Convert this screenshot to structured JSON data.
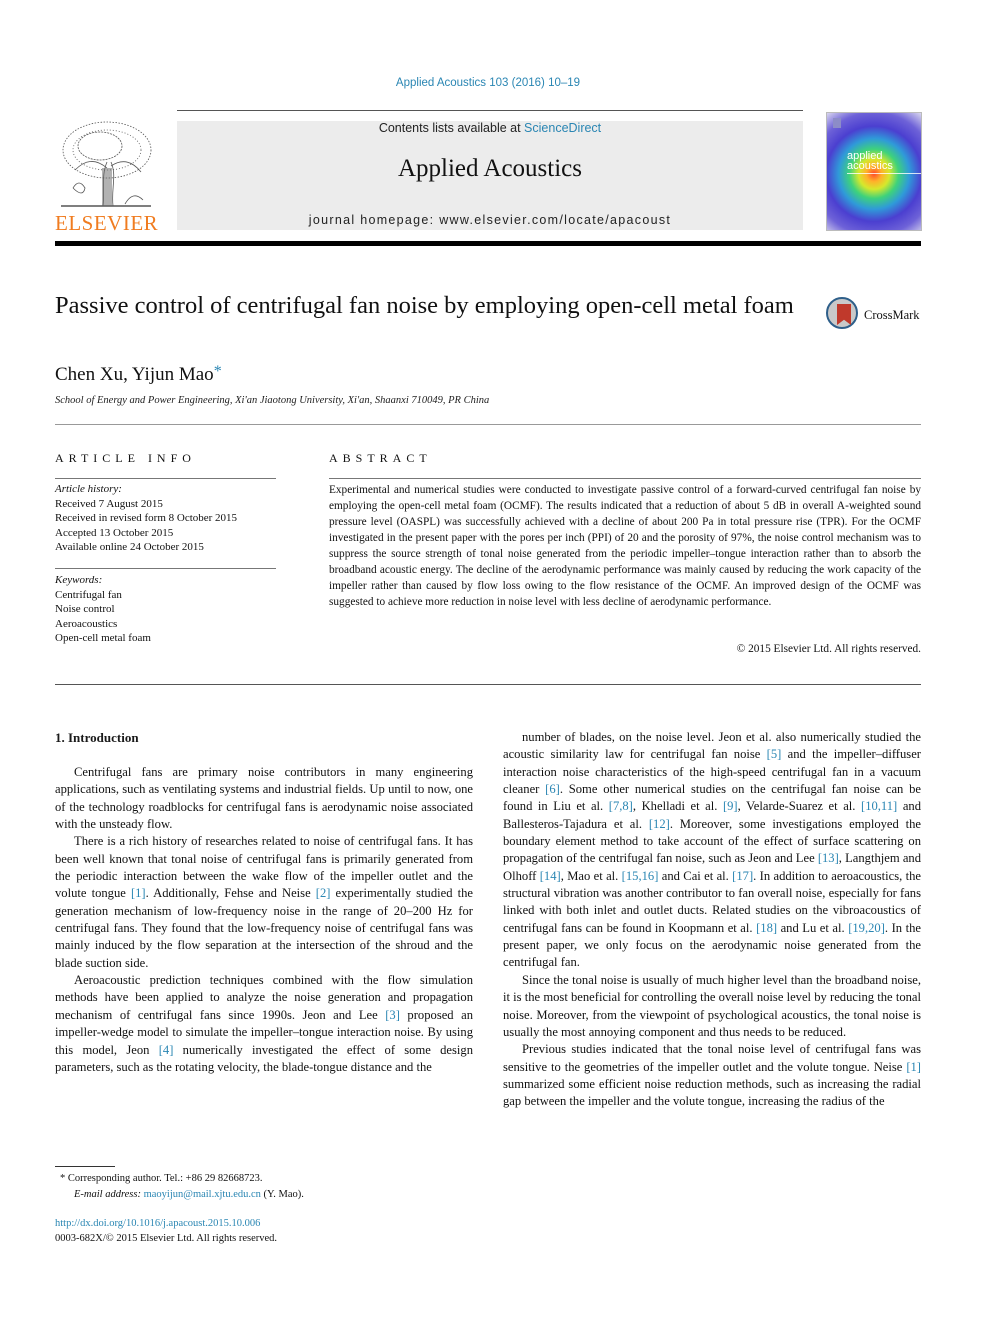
{
  "header": {
    "journal_ref": "Applied Acoustics 103 (2016) 10–19",
    "contents_prefix": "Contents lists available at ",
    "contents_link": "ScienceDirect",
    "journal_title": "Applied Acoustics",
    "homepage": "journal homepage: www.elsevier.com/locate/apacoust",
    "publisher_logo_text": "ELSEVIER",
    "cover_text_line1": "applied",
    "cover_text_line2": "acoustics",
    "crossmark_label": "CrossMark"
  },
  "article": {
    "title": "Passive control of centrifugal fan noise by employing open-cell metal foam",
    "authors": "Chen Xu, Yijun Mao",
    "author_star": "*",
    "affiliation": "School of Energy and Power Engineering, Xi'an Jiaotong University, Xi'an, Shaanxi 710049, PR China"
  },
  "article_info": {
    "heading": "ARTICLE INFO",
    "history_label": "Article history:",
    "history": [
      "Received 7 August 2015",
      "Received in revised form 8 October 2015",
      "Accepted 13 October 2015",
      "Available online 24 October 2015"
    ],
    "keywords_label": "Keywords:",
    "keywords": [
      "Centrifugal fan",
      "Noise control",
      "Aeroacoustics",
      "Open-cell metal foam"
    ]
  },
  "abstract": {
    "heading": "ABSTRACT",
    "text": "Experimental and numerical studies were conducted to investigate passive control of a forward-curved centrifugal fan noise by employing the open-cell metal foam (OCMF). The results indicated that a reduction of about 5 dB in overall A-weighted sound pressure level (OASPL) was successfully achieved with a decline of about 200 Pa in total pressure rise (TPR). For the OCMF investigated in the present paper with the pores per inch (PPI) of 20 and the porosity of 97%, the noise control mechanism was to suppress the source strength of tonal noise generated from the periodic impeller–tongue interaction rather than to absorb the broadband acoustic energy. The decline of the aerodynamic performance was mainly caused by reducing the work capacity of the impeller rather than caused by flow loss owing to the flow resistance of the OCMF. An improved design of the OCMF was suggested to achieve more reduction in noise level with less decline of aerodynamic performance.",
    "copyright": "© 2015 Elsevier Ltd. All rights reserved."
  },
  "body": {
    "section_heading": "1. Introduction",
    "left_paragraphs": [
      [
        {
          "t": "Centrifugal fans are primary noise contributors in many engineering applications, such as ventilating systems and industrial fields. Up until to now, one of the technology roadblocks for centrifugal fans is aerodynamic noise associated with the unsteady flow."
        }
      ],
      [
        {
          "t": "There is a rich history of researches related to noise of centrifugal fans. It has been well known that tonal noise of centrifugal fans is primarily generated from the periodic interaction between the wake flow of the impeller outlet and the volute tongue "
        },
        {
          "ref": "[1]"
        },
        {
          "t": ". Additionally, Fehse and Neise "
        },
        {
          "ref": "[2]"
        },
        {
          "t": " experimentally studied the generation mechanism of low-frequency noise in the range of 20–200 Hz for centrifugal fans. They found that the low-frequency noise of centrifugal fans was mainly induced by the flow separation at the intersection of the shroud and the blade suction side."
        }
      ],
      [
        {
          "t": "Aeroacoustic prediction techniques combined with the flow simulation methods have been applied to analyze the noise generation and propagation mechanism of centrifugal fans since 1990s. Jeon and Lee "
        },
        {
          "ref": "[3]"
        },
        {
          "t": " proposed an impeller-wedge model to simulate the impeller–tongue interaction noise. By using this model, Jeon "
        },
        {
          "ref": "[4]"
        },
        {
          "t": " numerically investigated the effect of some design parameters, such as the rotating velocity, the blade-tongue distance and the"
        }
      ]
    ],
    "right_paragraphs": [
      [
        {
          "t": "number of blades, on the noise level. Jeon et al. also numerically studied the acoustic similarity law for centrifugal fan noise "
        },
        {
          "ref": "[5]"
        },
        {
          "t": " and the impeller–diffuser interaction noise characteristics of the high-speed centrifugal fan in a vacuum cleaner "
        },
        {
          "ref": "[6]"
        },
        {
          "t": ". Some other numerical studies on the centrifugal fan noise can be found in Liu et al. "
        },
        {
          "ref": "[7,8]"
        },
        {
          "t": ", Khelladi et al. "
        },
        {
          "ref": "[9]"
        },
        {
          "t": ", Velarde-Suarez et al. "
        },
        {
          "ref": "[10,11]"
        },
        {
          "t": " and Ballesteros-Tajadura et al. "
        },
        {
          "ref": "[12]"
        },
        {
          "t": ". Moreover, some investigations employed the boundary element method to take account of the effect of surface scattering on propagation of the centrifugal fan noise, such as Jeon and Lee "
        },
        {
          "ref": "[13]"
        },
        {
          "t": ", Langthjem and Olhoff "
        },
        {
          "ref": "[14]"
        },
        {
          "t": ", Mao et al. "
        },
        {
          "ref": "[15,16]"
        },
        {
          "t": " and Cai et al. "
        },
        {
          "ref": "[17]"
        },
        {
          "t": ". In addition to aeroacoustics, the structural vibration was another contributor to fan overall noise, especially for fans linked with both inlet and outlet ducts. Related studies on the vibroacoustics of centrifugal fans can be found in Koopmann et al. "
        },
        {
          "ref": "[18]"
        },
        {
          "t": " and Lu et al. "
        },
        {
          "ref": "[19,20]"
        },
        {
          "t": ". In the present paper, we only focus on the aerodynamic noise generated from the centrifugal fan."
        }
      ],
      [
        {
          "t": "Since the tonal noise is usually of much higher level than the broadband noise, it is the most beneficial for controlling the overall noise level by reducing the tonal noise. Moreover, from the viewpoint of psychological acoustics, the tonal noise is usually the most annoying component and thus needs to be reduced."
        }
      ],
      [
        {
          "t": "Previous studies indicated that the tonal noise level of centrifugal fans was sensitive to the geometries of the impeller outlet and the volute tongue. Neise "
        },
        {
          "ref": "[1]"
        },
        {
          "t": " summarized some efficient noise reduction methods, such as increasing the radial gap between the impeller and the volute tongue, increasing the radius of the"
        }
      ]
    ]
  },
  "footnote": {
    "star": "*",
    "corresponding": "Corresponding author. Tel.: +86 29 82668723.",
    "email_label": "E-mail address:",
    "email": "maoyijun@mail.xjtu.edu.cn",
    "email_suffix": "(Y. Mao).",
    "doi": "http://dx.doi.org/10.1016/j.apacoust.2015.10.006",
    "issn_line": "0003-682X/© 2015 Elsevier Ltd. All rights reserved."
  },
  "colors": {
    "link": "#2a86b3",
    "elsevier_orange": "#f07c20",
    "masthead_gray": "#ececec"
  }
}
